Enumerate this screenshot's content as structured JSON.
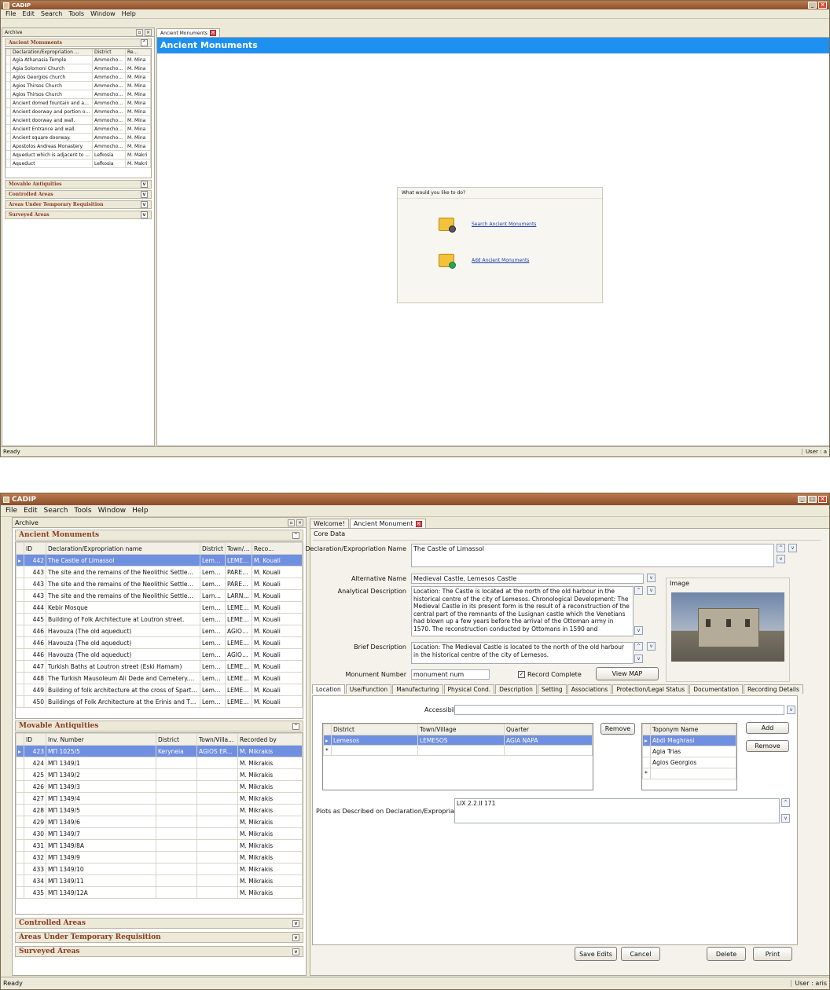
{
  "app": {
    "title": "CADIP",
    "menu": [
      "File",
      "Edit",
      "Search",
      "Tools",
      "Window",
      "Help"
    ],
    "status": "Ready"
  },
  "s1": {
    "archive_label": "Archive",
    "tab": "Ancient Monuments",
    "banner": "Ancient Monuments",
    "user": "User : a",
    "am_header": "Ancient Monuments",
    "cols": [
      "Declaration/Expropriation ...",
      "District",
      "Re..."
    ],
    "rows": [
      [
        "Agia Athanasia Temple",
        "Ammochos...",
        "M. Mina"
      ],
      [
        "Agia Solomoni Church",
        "Ammochos...",
        "M. Mina"
      ],
      [
        "Agios Georgios church",
        "Ammochos...",
        "M. Mina"
      ],
      [
        "Agios Thirsos Church",
        "Ammochos...",
        "M. Mina"
      ],
      [
        "Agios Thirsos Church",
        "Ammochos...",
        "M. Mina"
      ],
      [
        "Ancient domed fountain and an...",
        "Ammochos...",
        "M. Mina"
      ],
      [
        "Ancient doorway and portion of...",
        "Ammochos...",
        "M. Mina"
      ],
      [
        "Ancient doorway and wall.",
        "Ammochos...",
        "M. Mina"
      ],
      [
        "Ancient Entrance and wall.",
        "Ammochos...",
        "M. Mina"
      ],
      [
        "Ancient square doorway.",
        "Ammochos...",
        "M. Mina"
      ],
      [
        "Apostolos Andreas Monastery",
        "Ammochos...",
        "M. Mina"
      ],
      [
        "Aqueduct which is adjacent to ...",
        "Lefkosia",
        "M. Makri"
      ],
      [
        "Aqueduct",
        "Lefkosia",
        "M. Makri"
      ]
    ],
    "sections": [
      "Movable Antiquities",
      "Controlled Areas",
      "Areas Under Temporary Requisition",
      "Surveyed Areas"
    ],
    "prompt": "What would you like to do?",
    "search_link": "Search Ancient Monuments",
    "add_link": "Add Ancient Monuments"
  },
  "s2": {
    "archive_label": "Archive",
    "user": "User : aris",
    "tabs": [
      "Welcome!",
      "Ancient Monument"
    ],
    "am_header": "Ancient Monuments",
    "am_cols": [
      "ID",
      "Declaration/Expropriation name",
      "District",
      "Town/...",
      "Reco..."
    ],
    "am_rows": [
      [
        "442",
        "The Castle of Limassol",
        "Lemesos",
        "LEMES...",
        "M. Kouali"
      ],
      [
        "443",
        "The site and the remains of the Neolithic Settlement...",
        "Lemesos",
        "PAREK...",
        "M. Kouali"
      ],
      [
        "443",
        "The site and the remains of the Neolithic Settlement...",
        "Lemesos",
        "PAREK...",
        "M. Kouali"
      ],
      [
        "443",
        "The site and the remains of the Neolithic Settlement...",
        "Larnaka",
        "LARNA...",
        "M. Kouali"
      ],
      [
        "444",
        "Kebir Mosque",
        "Lemesos",
        "LEMES...",
        "M. Kouali"
      ],
      [
        "445",
        "Building of Folk Architecture at Loutron street.",
        "Lemesos",
        "LEMES...",
        "M. Kouali"
      ],
      [
        "446",
        "Havouza (The old aqueduct)",
        "Lemesos",
        "AGIOS ...",
        "M. Kouali"
      ],
      [
        "446",
        "Havouza (The old aqueduct)",
        "Lemesos",
        "LEMES...",
        "M. Kouali"
      ],
      [
        "446",
        "Havouza (The old aqueduct)",
        "Lemesos",
        "AGIOS ...",
        "M. Kouali"
      ],
      [
        "447",
        "Turkish Baths at Loutron street (Eski Hamam)",
        "Lemesos",
        "LEMES...",
        "M. Kouali"
      ],
      [
        "448",
        "The Turkish Mausoleum Ali Dede and Cemetery.Qua...",
        "Lemesos",
        "LEMES...",
        "M. Kouali"
      ],
      [
        "449",
        "Building of folk architecture at the cross of Sparts a...",
        "Lemesos",
        "LEMES...",
        "M. Kouali"
      ],
      [
        "450",
        "Buildings of Folk Architecture at the Erinis and Tzam...",
        "Lemesos",
        "LEMES...",
        "M. Kouali"
      ]
    ],
    "ma_header": "Movable Antiquities",
    "ma_cols": [
      "ID",
      "Inv. Number",
      "District",
      "Town/Villa...",
      "Recorded by"
    ],
    "ma_rows": [
      [
        "423",
        "MΠ 1025/5",
        "Keryneia",
        "AGIOS ER...",
        "M. Mikrakis"
      ],
      [
        "424",
        "MΠ 1349/1",
        "",
        "",
        "M. Mikrakis"
      ],
      [
        "425",
        "MΠ 1349/2",
        "",
        "",
        "M. Mikrakis"
      ],
      [
        "426",
        "MΠ 1349/3",
        "",
        "",
        "M. Mikrakis"
      ],
      [
        "427",
        "MΠ 1349/4",
        "",
        "",
        "M. Mikrakis"
      ],
      [
        "428",
        "MΠ 1349/5",
        "",
        "",
        "M. Mikrakis"
      ],
      [
        "429",
        "MΠ 1349/6",
        "",
        "",
        "M. Mikrakis"
      ],
      [
        "430",
        "MΠ 1349/7",
        "",
        "",
        "M. Mikrakis"
      ],
      [
        "431",
        "MΠ 1349/8A",
        "",
        "",
        "M. Mikrakis"
      ],
      [
        "432",
        "MΠ 1349/9",
        "",
        "",
        "M. Mikrakis"
      ],
      [
        "433",
        "MΠ 1349/10",
        "",
        "",
        "M. Mikrakis"
      ],
      [
        "434",
        "MΠ 1349/11",
        "",
        "",
        "M. Mikrakis"
      ],
      [
        "435",
        "MΠ 1349/12A",
        "",
        "",
        "M. Mikrakis"
      ]
    ],
    "sections": [
      "Controlled Areas",
      "Areas Under Temporary Requisition",
      "Surveyed Areas"
    ],
    "core": "Core Data",
    "lbl_decl": "Declaration/Expropriation Name",
    "val_decl": "The Castle of Limassol",
    "lbl_alt": "Alternative Name",
    "val_alt": "Medieval Castle, Lemesos Castle",
    "lbl_anal": "Analytical Description",
    "val_anal": "Location: The Castle is located at the north of the old harbour in the historical centre of the city of Lemesos. Chronological Development: The Medieval Castle in its present form is the result of a reconstruction of the central part of the remnants of the Lusignan castle which the Venetians had blown up a few years before the arrival of the Ottoman army in 1570. The reconstruction conducted by Ottomans in 1590 and",
    "lbl_brief": "Brief Description",
    "val_brief": "Location: The Medieval Castle is located to the north of the old harbour in the historical centre of the city of Lemesos.",
    "lbl_num": "Monument Number",
    "val_num": "monument num",
    "record_complete": "Record Complete",
    "view_map": "View MAP",
    "image_label": "Image",
    "subtabs": [
      "Location",
      "Use/Function",
      "Manufacturing",
      "Physical Cond.",
      "Description",
      "Setting",
      "Associations",
      "Protection/Legal Status",
      "Documentation",
      "Recording Details"
    ],
    "lbl_access": "Accessibility",
    "loc_cols": [
      "District",
      "Town/Village",
      "Quarter"
    ],
    "loc_row": [
      "Lemesos",
      "LEMESOS",
      "AGIA NAPA"
    ],
    "remove1": "Remove",
    "top_col": "Toponym Name",
    "toponyms": [
      "Abdi Maghrasi",
      "Agia Trias",
      "Agios Georgios"
    ],
    "add": "Add",
    "remove2": "Remove",
    "lbl_plots": "Plots as Described on Declaration/Expropriation",
    "val_plots": "LIX 2.2.II 171",
    "save": "Save Edits",
    "cancel": "Cancel",
    "delete": "Delete",
    "print": "Print"
  }
}
